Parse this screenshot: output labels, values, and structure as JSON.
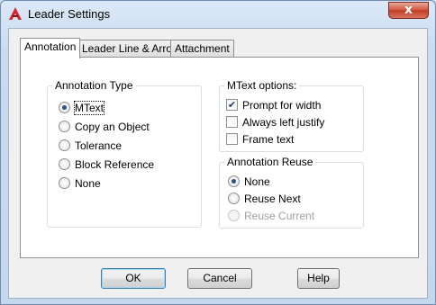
{
  "window": {
    "title": "Leader Settings",
    "close_glyph": "x",
    "accent_close": "#c23c22",
    "app_icon": "autocad-a-icon"
  },
  "tabs": [
    {
      "label": "Annotation",
      "active": true
    },
    {
      "label": "Leader Line & Arrow",
      "active": false
    },
    {
      "label": "Attachment",
      "active": false
    }
  ],
  "annotation_type": {
    "title": "Annotation Type",
    "options": [
      {
        "label": "MText",
        "selected": true
      },
      {
        "label": "Copy an Object",
        "selected": false
      },
      {
        "label": "Tolerance",
        "selected": false
      },
      {
        "label": "Block Reference",
        "selected": false
      },
      {
        "label": "None",
        "selected": false
      }
    ]
  },
  "mtext_options": {
    "title": "MText options:",
    "options": [
      {
        "label": "Prompt for width",
        "checked": true
      },
      {
        "label": "Always left justify",
        "checked": false
      },
      {
        "label": "Frame text",
        "checked": false
      }
    ]
  },
  "annotation_reuse": {
    "title": "Annotation Reuse",
    "options": [
      {
        "label": "None",
        "selected": true,
        "enabled": true
      },
      {
        "label": "Reuse Next",
        "selected": false,
        "enabled": true
      },
      {
        "label": "Reuse Current",
        "selected": false,
        "enabled": false
      }
    ]
  },
  "buttons": {
    "ok": "OK",
    "cancel": "Cancel",
    "help": "Help"
  }
}
